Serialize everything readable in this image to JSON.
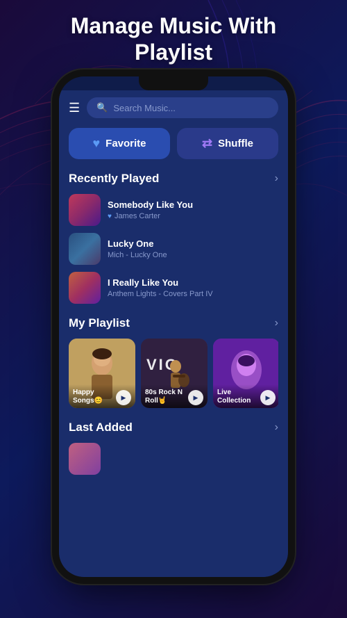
{
  "hero": {
    "title_line1": "Manage Music With",
    "title_line2": "Playlist"
  },
  "search": {
    "placeholder": "Search Music...",
    "icon": "search"
  },
  "buttons": {
    "favorite": "Favorite",
    "shuffle": "Shuffle"
  },
  "recently_played": {
    "section_title": "Recently Played",
    "tracks": [
      {
        "name": "Somebody Like You",
        "artist": "James Carter",
        "has_heart": true
      },
      {
        "name": "Lucky One",
        "artist": "Mich - Lucky One",
        "has_heart": false
      },
      {
        "name": "I Really Like You",
        "artist": "Anthem Lights - Covers Part IV",
        "has_heart": false
      }
    ]
  },
  "my_playlist": {
    "section_title": "My Playlist",
    "playlists": [
      {
        "label": "Happy Songs😊"
      },
      {
        "label": "80s Rock N Roll🤘"
      },
      {
        "label": "Live Collection"
      }
    ]
  },
  "last_added": {
    "section_title": "Last Added"
  }
}
